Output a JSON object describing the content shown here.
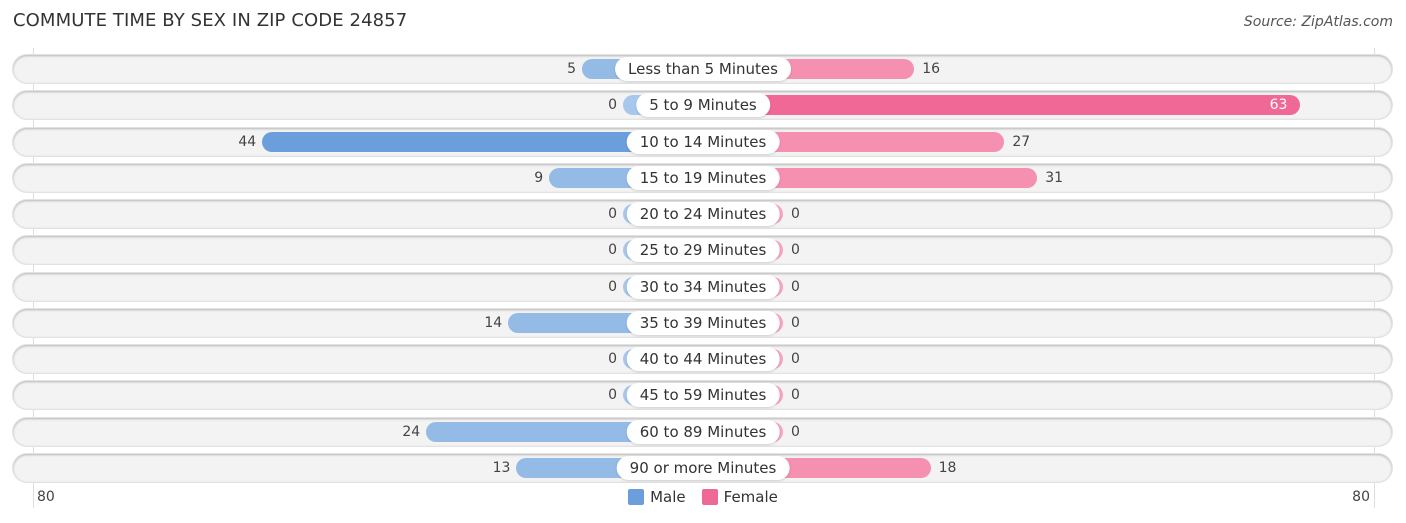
{
  "header": {
    "title": "COMMUTE TIME BY SEX IN ZIP CODE 24857",
    "source": "Source: ZipAtlas.com"
  },
  "chart_data": {
    "type": "bar",
    "orientation": "horizontal-diverging",
    "title": "COMMUTE TIME BY SEX IN ZIP CODE 24857",
    "categories": [
      "Less than 5 Minutes",
      "5 to 9 Minutes",
      "10 to 14 Minutes",
      "15 to 19 Minutes",
      "20 to 24 Minutes",
      "25 to 29 Minutes",
      "30 to 34 Minutes",
      "35 to 39 Minutes",
      "40 to 44 Minutes",
      "45 to 59 Minutes",
      "60 to 89 Minutes",
      "90 or more Minutes"
    ],
    "series": [
      {
        "name": "Male",
        "color": "#6a9fdc",
        "values": [
          5,
          0,
          44,
          9,
          0,
          0,
          0,
          14,
          0,
          0,
          24,
          13
        ]
      },
      {
        "name": "Female",
        "color": "#f06896",
        "values": [
          16,
          63,
          27,
          31,
          0,
          0,
          0,
          0,
          0,
          0,
          0,
          18
        ]
      }
    ],
    "axis": {
      "left_tick": "80",
      "right_tick": "80",
      "range": [
        -80,
        80
      ]
    },
    "legend": {
      "position": "bottom-center",
      "items": [
        "Male",
        "Female"
      ]
    },
    "grid": false
  }
}
